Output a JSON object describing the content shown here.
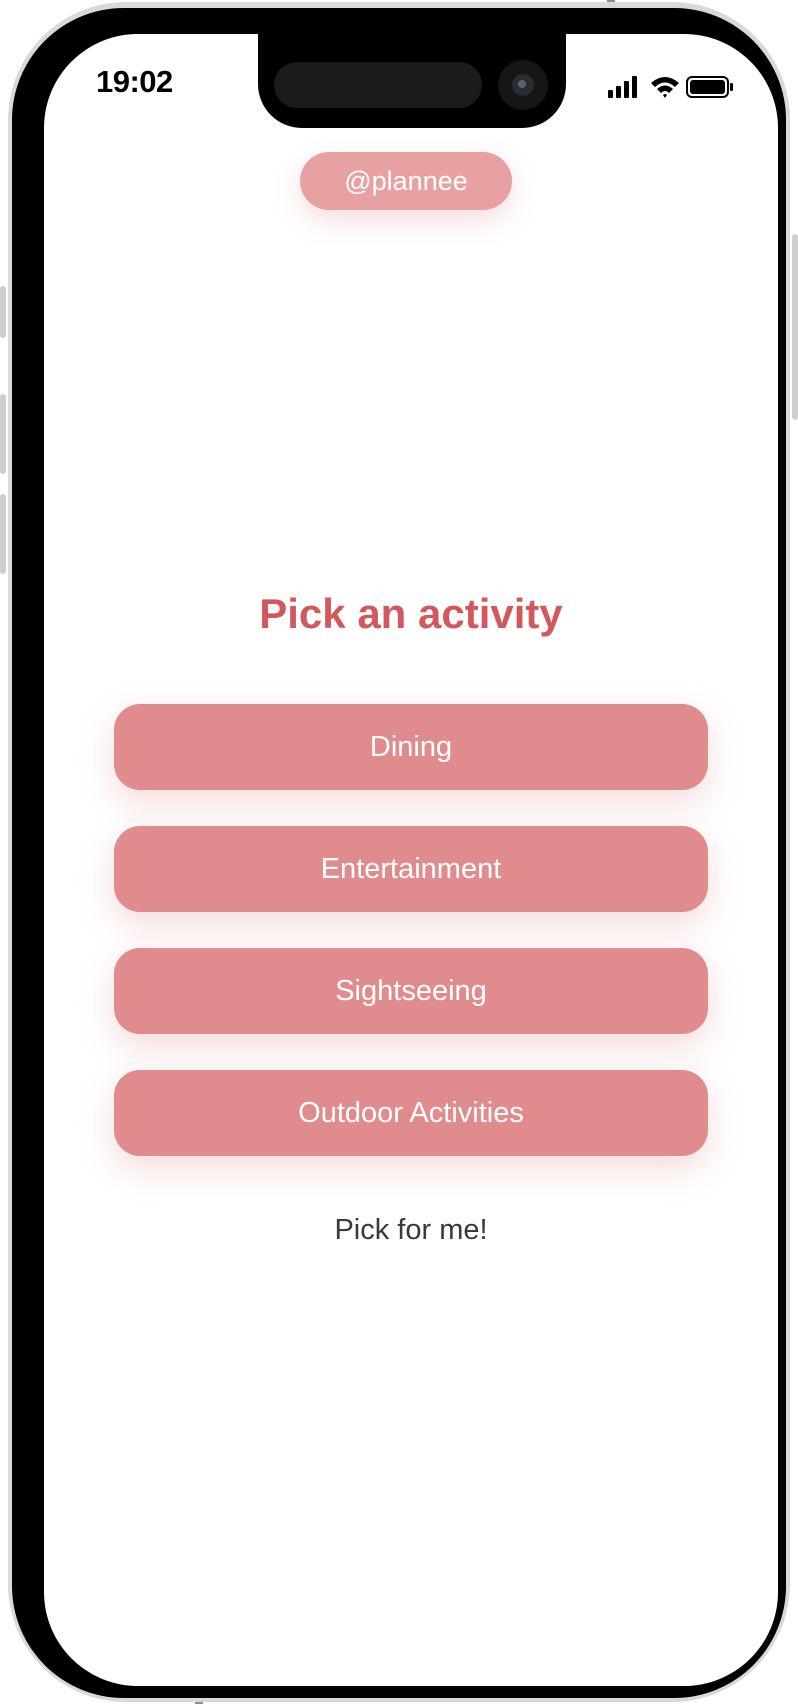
{
  "status_bar": {
    "time": "19:02",
    "icons": [
      "cellular-signal-icon",
      "wifi-icon",
      "battery-icon"
    ]
  },
  "header": {
    "handle": "@plannee"
  },
  "main": {
    "title": "Pick an activity",
    "activities": [
      {
        "label": "Dining"
      },
      {
        "label": "Entertainment"
      },
      {
        "label": "Sightseeing"
      },
      {
        "label": "Outdoor Activities"
      }
    ],
    "pick_for_me": "Pick for me!"
  },
  "colors": {
    "accent": "#d3585c",
    "button": "#e08b8d",
    "pill": "#e8a1a3",
    "text_dark": "#3a3a3a"
  }
}
